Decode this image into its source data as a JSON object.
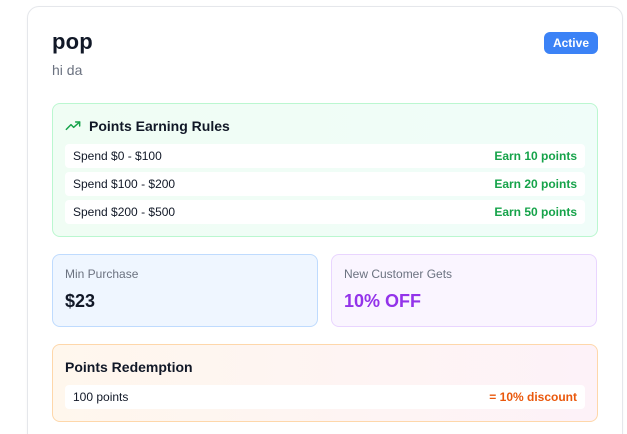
{
  "program": {
    "title": "pop",
    "subtitle": "hi da",
    "status": "Active"
  },
  "earning": {
    "heading": "Points Earning Rules",
    "icon": "trending-up-icon",
    "rules": [
      {
        "range": "Spend $0 - $100",
        "points": "Earn 10 points"
      },
      {
        "range": "Spend $100 - $200",
        "points": "Earn 20 points"
      },
      {
        "range": "Spend $200 - $500",
        "points": "Earn 50 points"
      }
    ]
  },
  "stats": {
    "min_purchase": {
      "label": "Min Purchase",
      "value": "$23"
    },
    "new_customer": {
      "label": "New Customer Gets",
      "value": "10% OFF"
    }
  },
  "redemption": {
    "heading": "Points Redemption",
    "points": "100 points",
    "discount": "= 10% discount"
  },
  "colors": {
    "badge": "#3b82f6",
    "earn_accent": "#16a34a",
    "offer_accent": "#9333ea",
    "discount_accent": "#ea580c"
  }
}
